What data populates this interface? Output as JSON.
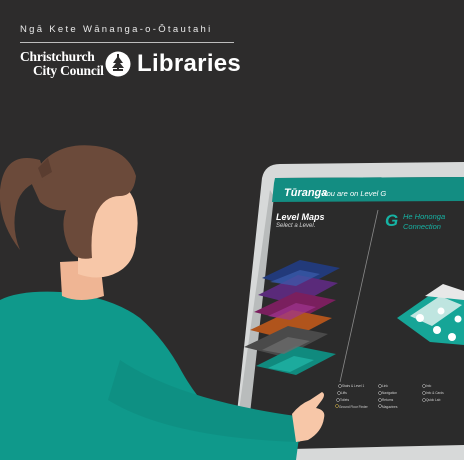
{
  "brand": {
    "tagline": "Ngā Kete Wānanga-o-Ōtautahi",
    "council_line1": "Christchurch",
    "council_line2": "City Council",
    "libraries": "Libraries"
  },
  "kiosk": {
    "title": "Tūranga",
    "location": "You are on Level G",
    "level_maps_title": "Level Maps",
    "level_maps_sub": "Select a Level.",
    "level_letter": "G",
    "level_name": "He Hononga",
    "level_sub": "Connection",
    "legend": [
      "Stairs & Level 1",
      "Lifts",
      "Toilets",
      "Ground Floor Finder",
      "Link",
      "Navigation",
      "Returns",
      "Magazines",
      "Info",
      "Info & Cards",
      "Quick Lab"
    ]
  },
  "colors": {
    "background": "#2d2c2c",
    "accent_teal": "#16b3a4",
    "shirt": "#0f998b",
    "skin": "#f7c7a8",
    "hair": "#6b4a3a"
  }
}
